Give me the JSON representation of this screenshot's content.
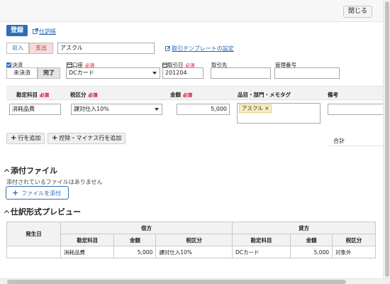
{
  "header": {
    "close_label": "閉じる"
  },
  "toolbar": {
    "register_label": "登録",
    "journal_link": "仕訳帳"
  },
  "type_toggle": {
    "income_label": "収入",
    "expense_label": "支出"
  },
  "partner_search": {
    "value": "アスクル"
  },
  "template_link": "取引テンプレートの設定",
  "settlement": {
    "label": "決済",
    "unsettled_label": "未決済",
    "complete_label": "完了"
  },
  "account": {
    "label": "口座",
    "required": "必須",
    "value": "DCカード"
  },
  "txn_date": {
    "label": "取引日",
    "required": "必須",
    "value": "201204"
  },
  "partner": {
    "label": "取引先",
    "value": ""
  },
  "mgmt_no": {
    "label": "管理番号",
    "value": ""
  },
  "grid": {
    "headers": {
      "account_item": "勘定科目",
      "tax_class": "税区分",
      "amount": "金額",
      "item_dept": "品目・部門・メモタグ",
      "remarks": "備考",
      "required": "必須"
    },
    "row": {
      "account_item": "消耗品費",
      "tax_class": "課対仕入10%",
      "amount": "5,000",
      "tag": "アスクル ×",
      "remarks": ""
    }
  },
  "actions": {
    "add_row": "行を追加",
    "add_deduction_row": "控除・マイナス行を追加"
  },
  "total_label": "合計",
  "attachments": {
    "title": "添付ファイル",
    "empty_text": "添付されているファイルはありません",
    "attach_button": "ファイルを添付"
  },
  "preview": {
    "title": "仕訳形式プレビュー",
    "headers": {
      "date": "発生日",
      "debit": "借方",
      "credit": "貸方",
      "account_item": "勘定科目",
      "amount": "金額",
      "tax_class": "税区分"
    },
    "row": {
      "date": "",
      "debit_account": "消耗品費",
      "debit_amount": "5,000",
      "debit_tax": "課対仕入10%",
      "credit_account": "DCカード",
      "credit_amount": "5,000",
      "credit_tax": "対象外"
    }
  },
  "colors": {
    "primary": "#2e6eb5",
    "required": "#d0021b",
    "expense_bg": "#f6dcdc",
    "tag_bg": "#f6eec1"
  }
}
